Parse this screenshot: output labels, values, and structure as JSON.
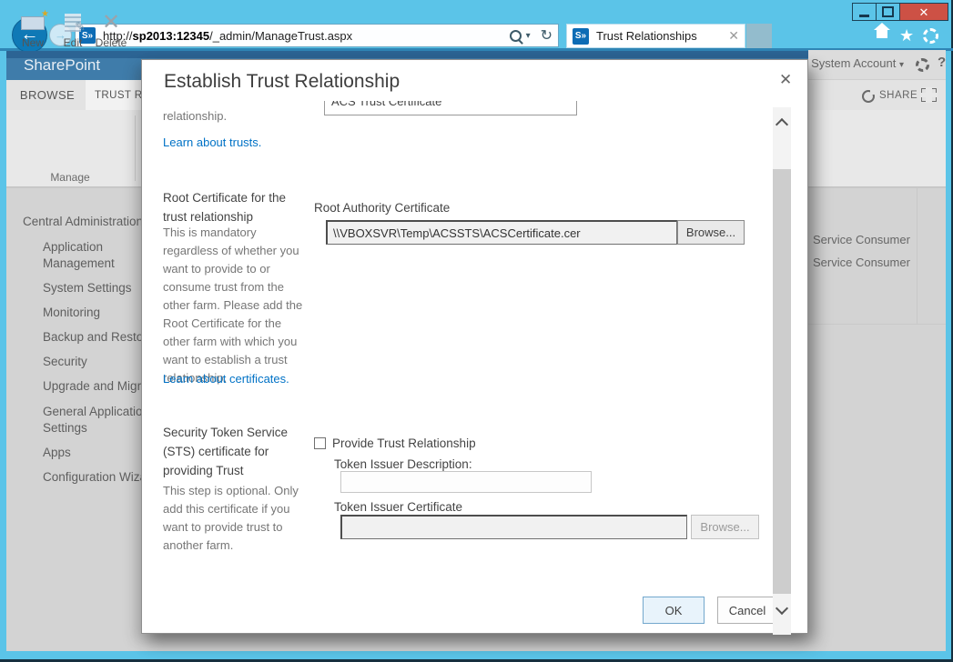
{
  "colors": {
    "titlebar_cyan": "#5bc4e8",
    "suite_blue": "#3f7caa",
    "link_blue": "#0072c6",
    "close_red": "#cd5145",
    "dialog_bg": "#ffffff",
    "page_dim_gray": "#d3d3d3"
  },
  "browser": {
    "url": {
      "scheme": "http://",
      "host": "sp2013:12345",
      "path": "/_admin/ManageTrust.aspx"
    },
    "tab": {
      "title": "Trust Relationships"
    }
  },
  "suite_bar": {
    "brand": "SharePoint",
    "account_label": "System Account",
    "help_label": "?"
  },
  "ribbon": {
    "tabs": [
      {
        "label": "BROWSE"
      },
      {
        "label": "TRUST RELATIONSHIPS"
      }
    ],
    "commands": [
      {
        "label": "New"
      },
      {
        "label": "Edit"
      },
      {
        "label": "Delete"
      }
    ],
    "group_label": "Manage",
    "share_label": "SHARE"
  },
  "sidebar": {
    "items": [
      "Central Administration",
      "Application Management",
      "System Settings",
      "Monitoring",
      "Backup and Restore",
      "Security",
      "Upgrade and Migration",
      "General Application Settings",
      "Apps",
      "Configuration Wizards"
    ]
  },
  "content": {
    "list_rows": [
      "Service Consumer",
      "Service Consumer"
    ]
  },
  "dialog": {
    "title": "Establish Trust Relationship",
    "clipped_input_value": "ACS Trust Certificate",
    "intro_fragment": "relationship.",
    "intro_link": "Learn about trusts.",
    "root": {
      "heading": "Root Certificate for the trust relationship",
      "body": "This is mandatory regardless of whether you want to provide to or consume trust from the other farm. Please add the Root Certificate for the other farm with which you want to establish a trust relationship.",
      "link": "Learn about certificates.",
      "field_label": "Root Authority Certificate",
      "field_value": "\\\\VBOXSVR\\Temp\\ACSSTS\\ACSCertificate.cer",
      "browse_label": "Browse..."
    },
    "sts": {
      "heading": "Security Token Service (STS) certificate for providing Trust",
      "body": "This step is optional. Only add this certificate if you want to provide trust to another farm.",
      "checkbox_label": "Provide Trust Relationship",
      "description_label": "Token Issuer Description:",
      "certificate_label": "Token Issuer Certificate",
      "browse_label": "Browse..."
    },
    "ok_label": "OK",
    "cancel_label": "Cancel"
  }
}
